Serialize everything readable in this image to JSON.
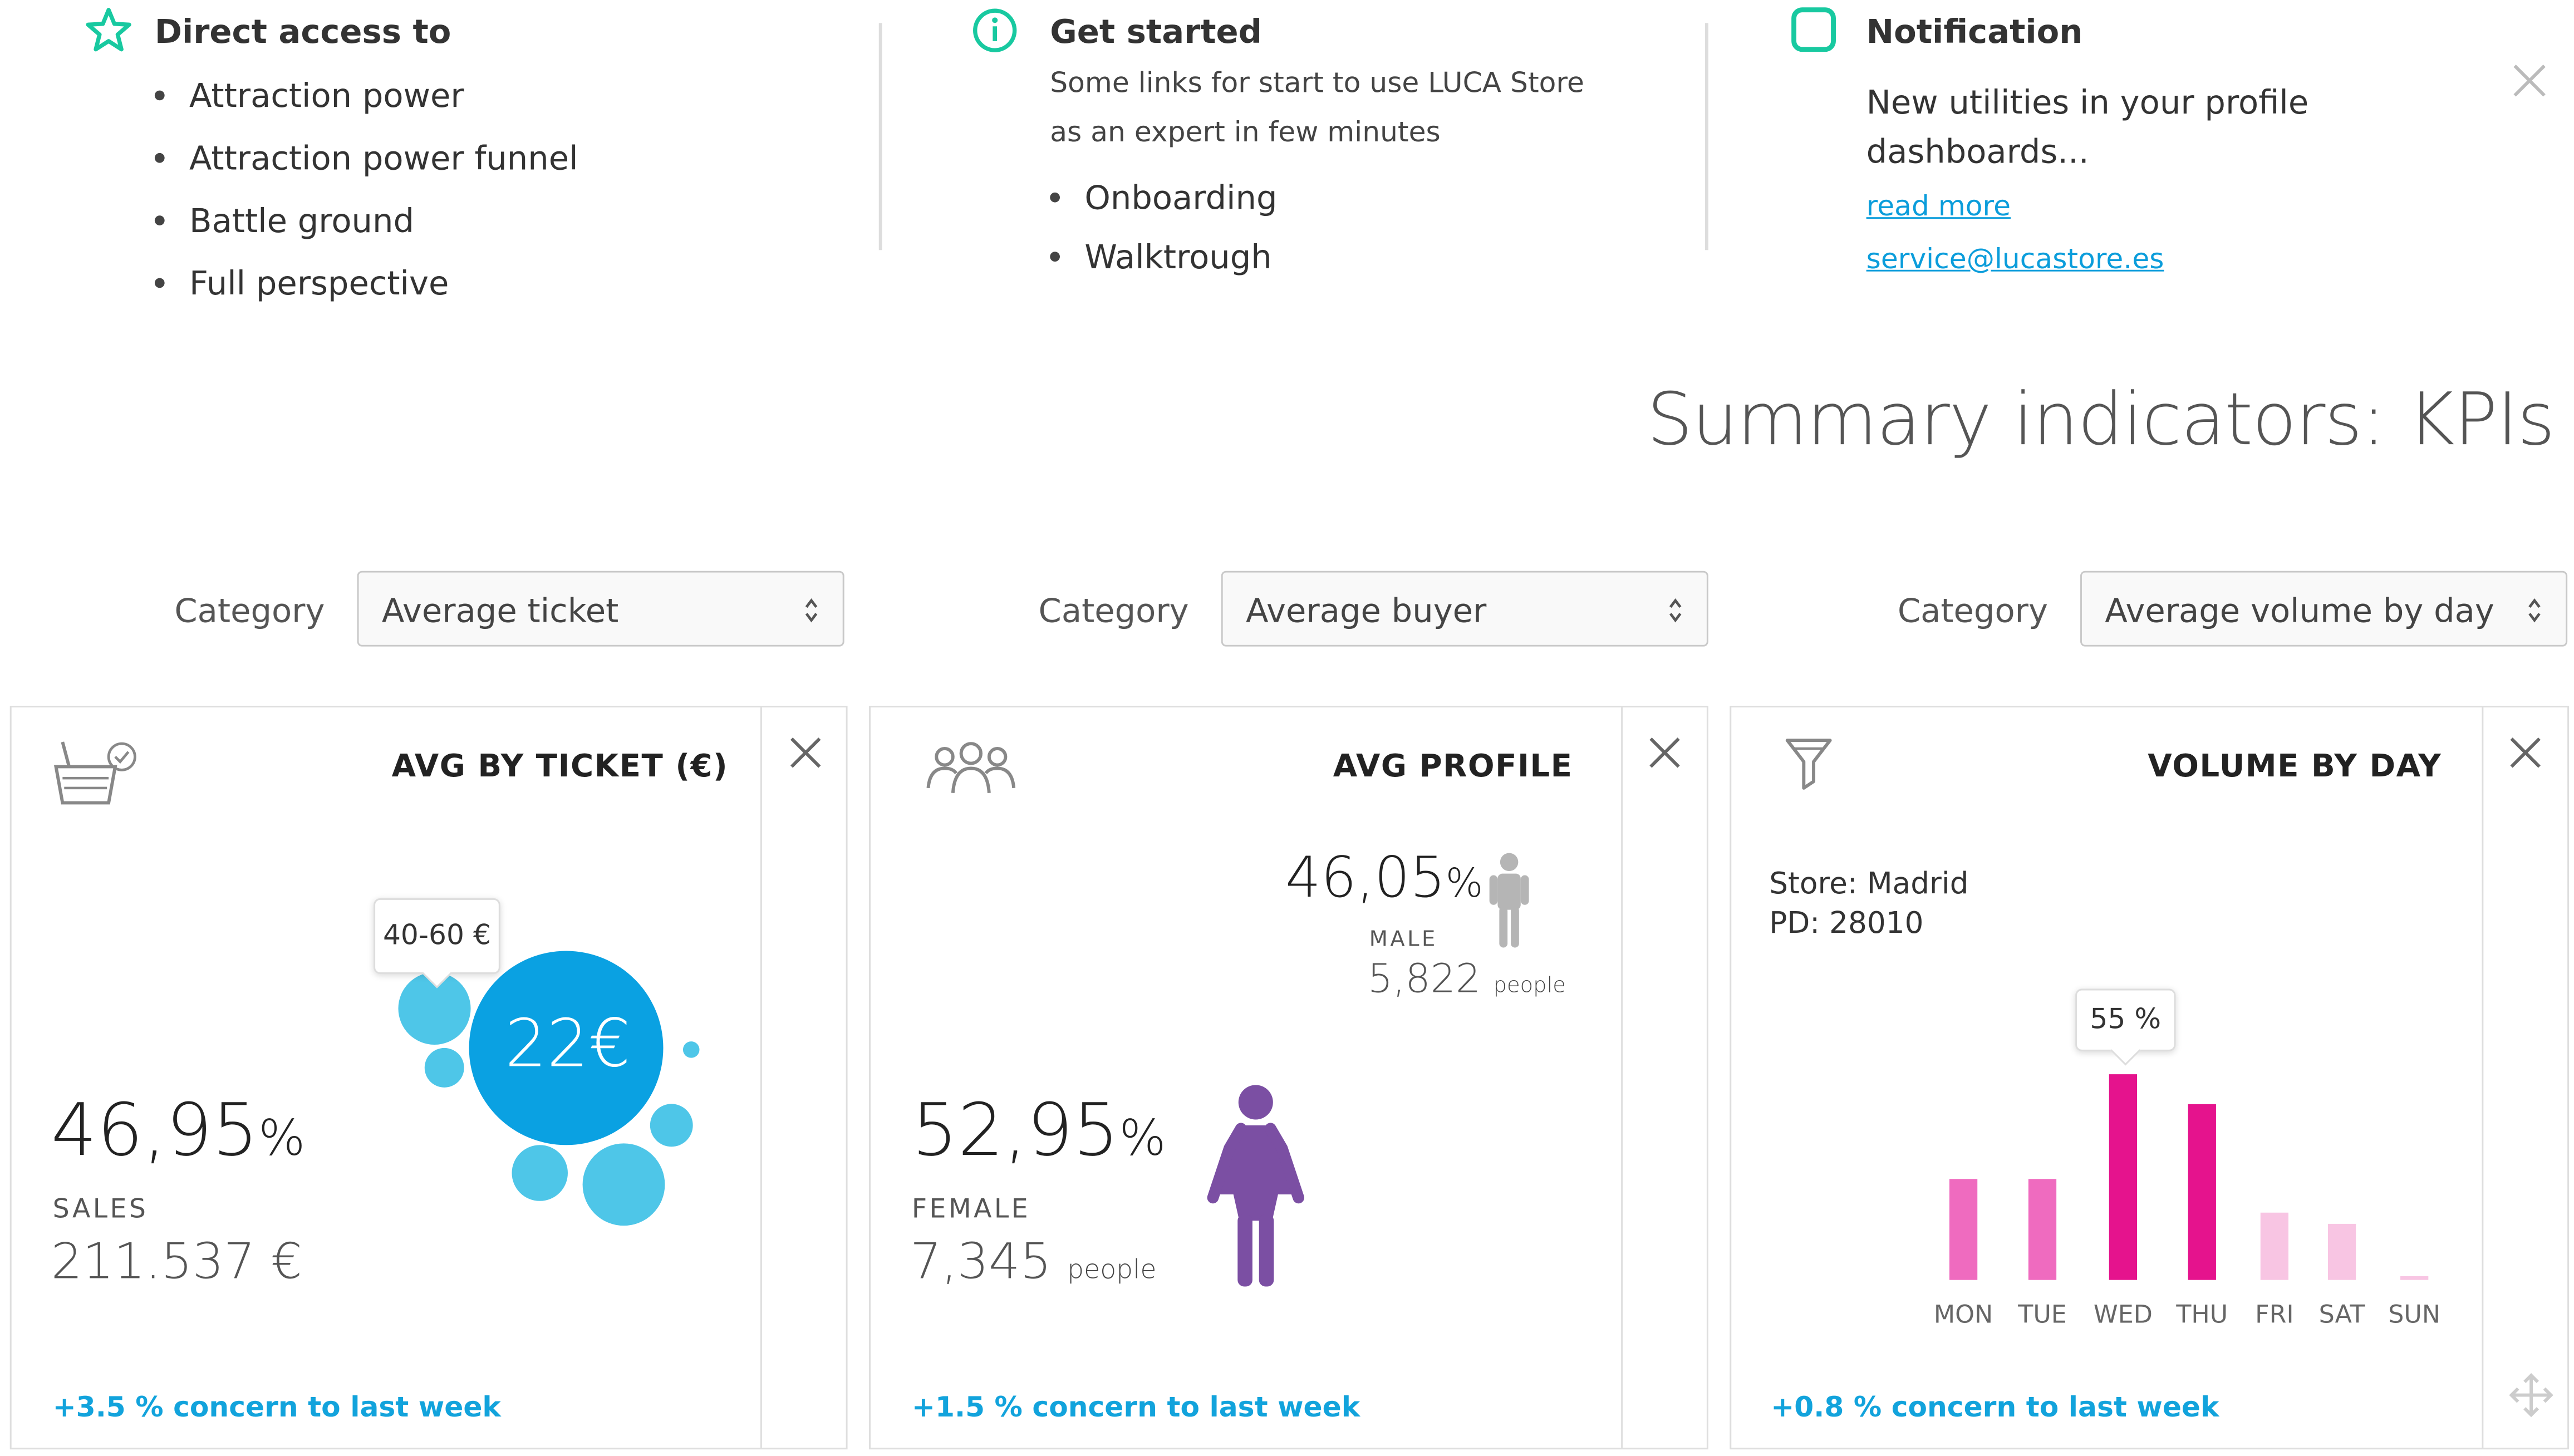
{
  "direct_access": {
    "title": "Direct access to",
    "items": [
      "Attraction power",
      "Attraction power funnel",
      "Battle ground",
      "Full perspective"
    ]
  },
  "get_started": {
    "title": "Get started",
    "description_line1": "Some links for start to use LUCA Store",
    "description_line2": "as an expert in few minutes",
    "items": [
      "Onboarding",
      "Walktrough"
    ]
  },
  "notification": {
    "title": "Notification",
    "text_line1": "New utilities in your profile",
    "text_line2": "dashboards...",
    "read_more": "read more",
    "email": "service@lucastore.es"
  },
  "kpis": {
    "heading": "Summary indicators: KPIs"
  },
  "filters": [
    {
      "label": "Category",
      "value": "Average ticket"
    },
    {
      "label": "Category",
      "value": "Average buyer"
    },
    {
      "label": "Category",
      "value": "Average volume by day"
    }
  ],
  "cards": {
    "ticket": {
      "title": "AVG BY TICKET (€)",
      "tooltip": "40-60 €",
      "bubble_value": "22€",
      "percent_value": "46,95",
      "percent_sign": "%",
      "metric_label": "SALES",
      "amount": "211.537 €",
      "concern": "+3.5 % concern to last week"
    },
    "profile": {
      "title": "AVG PROFILE",
      "male_percent": "46,05",
      "male_label": "MALE",
      "male_count": "5,822",
      "female_percent": "52,95",
      "female_label": "FEMALE",
      "female_count": "7,345",
      "percent_sign": "%",
      "people_unit": "people",
      "concern": "+1.5 % concern to last week"
    },
    "volume": {
      "title": "VOLUME BY DAY",
      "store": "Store: Madrid",
      "pd": "PD: 28010",
      "tooltip": "55 %",
      "concern": "+0.8 % concern to last week"
    }
  },
  "chart_data": {
    "type": "bar",
    "title": "VOLUME BY DAY",
    "categories": [
      "MON",
      "TUE",
      "WED",
      "THU",
      "FRI",
      "SAT",
      "SUN"
    ],
    "values": [
      27,
      27,
      55,
      47,
      18,
      15,
      1
    ],
    "highlight": {
      "category": "WED",
      "label": "55 %"
    },
    "ylim": [
      0,
      60
    ],
    "grid": false,
    "colors": [
      "#ef6bbf",
      "#ef6bbf",
      "#e5138d",
      "#e5138d",
      "#f8c5e3",
      "#f8c5e3",
      "#f8c5e3"
    ]
  },
  "colors": {
    "accent_blue": "#12a3dc",
    "bubble_blue": "#0aa1e2",
    "bubble_light": "#4ec6e8",
    "female_purple": "#7b4fa3",
    "male_gray": "#b5b5b5",
    "check_green": "#18c9a0",
    "bar_pink": "#e5138d"
  }
}
